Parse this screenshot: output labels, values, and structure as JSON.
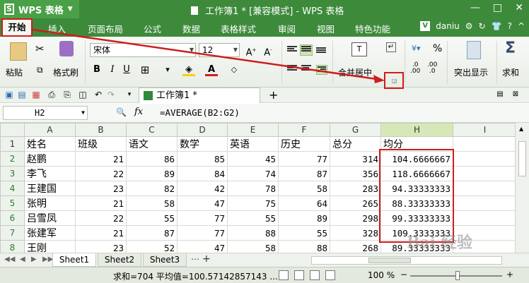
{
  "titlebar": {
    "app_name": "WPS 表格",
    "doc_title": "工作簿1 * [兼容模式] - WPS 表格",
    "minimize": "—",
    "maximize": "□",
    "close": "✕"
  },
  "menu": {
    "tabs": [
      "开始",
      "插入",
      "页面布局",
      "公式",
      "数据",
      "表格样式",
      "审阅",
      "视图",
      "特色功能"
    ],
    "user": "daniu"
  },
  "ribbon": {
    "paste": "粘贴",
    "format_painter": "格式刷",
    "font_name": "宋体",
    "font_size": "12",
    "bold": "B",
    "italic": "I",
    "underline": "U",
    "merge_center": "合并居中",
    "wrap_show": "突出显示",
    "sum": "求和",
    "percent": "%"
  },
  "qat": {
    "doc_tab": "工作簿1 *",
    "add_tab": "+"
  },
  "formula_bar": {
    "cell_ref": "H2",
    "fx": "fx",
    "formula": "=AVERAGE(B2:G2)"
  },
  "grid": {
    "columns": [
      "A",
      "B",
      "C",
      "D",
      "E",
      "F",
      "G",
      "H",
      "I"
    ],
    "headers": [
      "姓名",
      "班级",
      "语文",
      "数学",
      "英语",
      "历史",
      "总分",
      "均分",
      ""
    ],
    "rows": [
      {
        "num": "2",
        "cells": [
          "赵鹏",
          "21",
          "86",
          "85",
          "45",
          "77",
          "314",
          "104.6666667",
          ""
        ]
      },
      {
        "num": "3",
        "cells": [
          "李飞",
          "22",
          "89",
          "84",
          "74",
          "87",
          "356",
          "118.6666667",
          ""
        ]
      },
      {
        "num": "4",
        "cells": [
          "王建国",
          "23",
          "82",
          "42",
          "78",
          "58",
          "283",
          "94.33333333",
          ""
        ]
      },
      {
        "num": "5",
        "cells": [
          "张明",
          "21",
          "58",
          "47",
          "75",
          "64",
          "265",
          "88.33333333",
          ""
        ]
      },
      {
        "num": "6",
        "cells": [
          "吕雪凤",
          "22",
          "55",
          "77",
          "55",
          "89",
          "298",
          "99.33333333",
          ""
        ]
      },
      {
        "num": "7",
        "cells": [
          "张建军",
          "21",
          "87",
          "77",
          "88",
          "55",
          "328",
          "109.3333333",
          ""
        ]
      },
      {
        "num": "8",
        "cells": [
          "王刚",
          "23",
          "52",
          "47",
          "58",
          "88",
          "268",
          "89.33333333",
          ""
        ]
      }
    ]
  },
  "sheets": [
    "Sheet1",
    "Sheet2",
    "Sheet3"
  ],
  "status": {
    "text": "求和=704  平均值=100.57142857143 ...",
    "zoom": "100 %"
  },
  "watermark": "Bai 经验",
  "colors": {
    "title_green": "#3d8a3b",
    "annotation_red": "#d01c1c",
    "active_col": "#d7e8b8"
  }
}
